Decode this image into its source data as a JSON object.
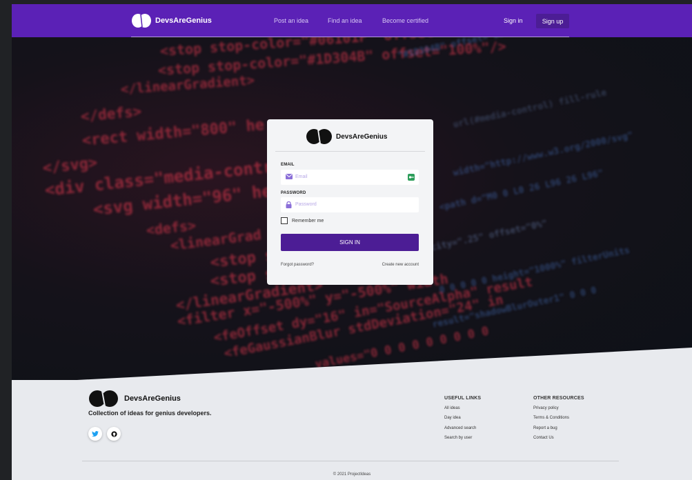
{
  "brand": {
    "name": "DevsAreGenius"
  },
  "nav": {
    "links": [
      "Post an idea",
      "Find an idea",
      "Become certified"
    ],
    "sign_in": "Sign in",
    "sign_up": "Sign up"
  },
  "background_code": [
    {
      "text": "<stop stop-color=\"#06101F\" offset=\"0%\"/>",
      "color": "#e6394f"
    },
    {
      "text": "<stop stop-color=\"#1D304B\" offset=\"100%\"/>",
      "color": "#e6394f"
    },
    {
      "text": "</linearGradient>",
      "color": "#e6394f"
    },
    {
      "text": "</defs>",
      "color": "#e6394f"
    },
    {
      "text": "<rect width=\"800\" he",
      "color": "#e6394f"
    },
    {
      "text": "</svg>",
      "color": "#e6394f"
    },
    {
      "text": "<div class=\"media-contr",
      "color": "#e6394f"
    },
    {
      "text": "<svg width=\"96\" hei",
      "color": "#e6394f"
    },
    {
      "text": "<defs>",
      "color": "#e6394f"
    },
    {
      "text": "<linearGrad",
      "color": "#e6394f"
    },
    {
      "text": "<stop s",
      "color": "#e6394f"
    },
    {
      "text": "<stop s",
      "color": "#e6394f"
    },
    {
      "text": "</linearGradient>",
      "color": "#e6394f"
    },
    {
      "text": "<filter x=\"-500%\" y=\"-500%\" width",
      "color": "#e6394f"
    },
    {
      "text": "<feOffset dy=\"16\" in=\"SourceAlpha\" result",
      "color": "#e6394f"
    },
    {
      "text": "<feGaussianBlur stdDeviation=\"24\" in",
      "color": "#e6394f"
    },
    {
      "text": "values=\"0 0 0 0 0 0 0 0 0",
      "color": "#e6394f"
    }
  ],
  "login": {
    "email_label": "EMAIL",
    "email_placeholder": "Email",
    "password_label": "PASSWORD",
    "password_placeholder": "Password",
    "remember_me": "Remember me",
    "sign_in_button": "SIGN IN",
    "forgot_password": "Forgot password?",
    "create_account": "Create new account"
  },
  "footer": {
    "tagline": "Collection of ideas for genius developers.",
    "useful_links": {
      "heading": "USEFUL LINKS",
      "items": [
        "All ideas",
        "Day idea",
        "Advanced search",
        "Search by user"
      ]
    },
    "other_resources": {
      "heading": "OTHER RESOURCES",
      "items": [
        "Privacy policy",
        "Terms & Conditions",
        "Report a bug",
        "Contact Us"
      ]
    },
    "copyright": "© 2021 ProjectIdeas"
  },
  "colors": {
    "primary": "#5b21b6",
    "primary_dark": "#4c1d95",
    "footer_bg": "#e8eaee",
    "card_bg": "#f3f4f6",
    "twitter": "#1da1f2"
  },
  "icons": {
    "logo": "two-rounded-blob-logo",
    "email": "envelope-icon",
    "password": "lock-icon",
    "email_trailing": "autofill-key-icon",
    "twitter": "twitter-icon",
    "github": "github-icon"
  }
}
